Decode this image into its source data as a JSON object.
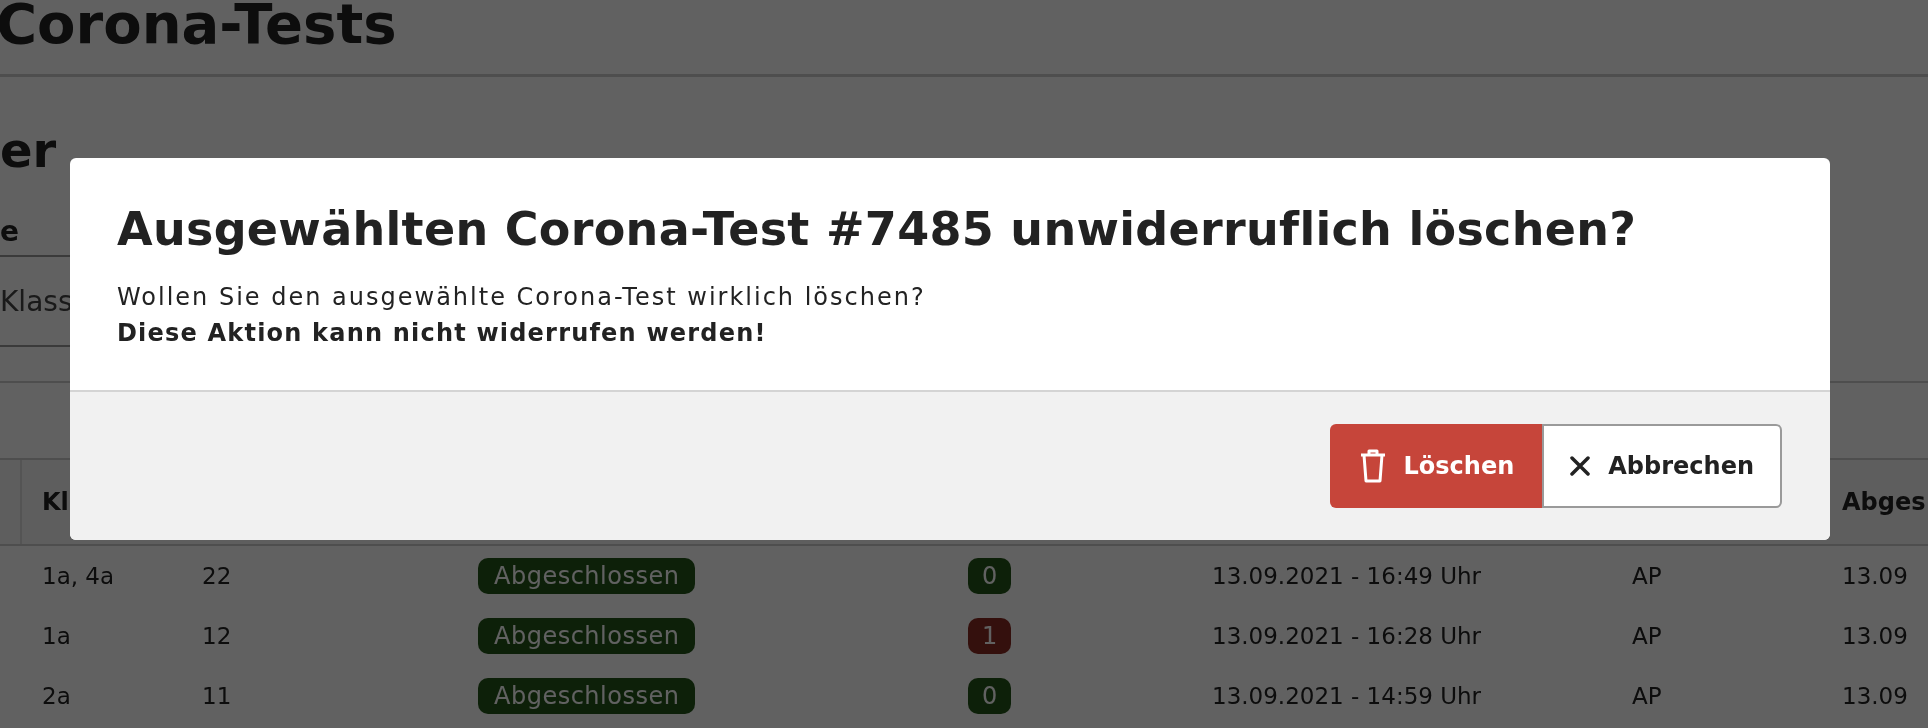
{
  "page": {
    "title": "Corona-Tests",
    "section_heading": "er",
    "filter": {
      "label": "e",
      "placeholder": "Klass"
    }
  },
  "table": {
    "columns": [
      {
        "label": "Kl"
      },
      {
        "label": "Abges"
      }
    ],
    "rows": [
      {
        "class": "1a, 4a",
        "count": "22",
        "status": {
          "label": "Abgeschlossen",
          "kind": "done"
        },
        "result": {
          "label": "0",
          "kind": "negative"
        },
        "date": "13.09.2021 - 16:49 Uhr",
        "by": "AP",
        "column_8": "13.09"
      },
      {
        "class": "1a",
        "count": "12",
        "status": {
          "label": "Abgeschlossen",
          "kind": "done"
        },
        "result": {
          "label": "1",
          "kind": "positive"
        },
        "date": "13.09.2021 - 16:28 Uhr",
        "by": "AP",
        "column_8": "13.09"
      },
      {
        "class": "2a",
        "count": "11",
        "status": {
          "label": "Abgeschlossen",
          "kind": "done"
        },
        "result": {
          "label": "0",
          "kind": "negative"
        },
        "date": "13.09.2021 - 14:59 Uhr",
        "by": "AP",
        "column_8": "13.09"
      }
    ]
  },
  "dialog": {
    "title": "Ausgewählten Corona-Test #7485 unwiderruflich löschen?",
    "message": "Wollen Sie den ausgewählte Corona-Test wirklich löschen?",
    "warning": "Diese Aktion kann nicht widerrufen werden!",
    "buttons": [
      {
        "label": "Löschen",
        "kind": "danger"
      },
      {
        "label": "Abbrechen",
        "kind": "cancel"
      }
    ]
  }
}
